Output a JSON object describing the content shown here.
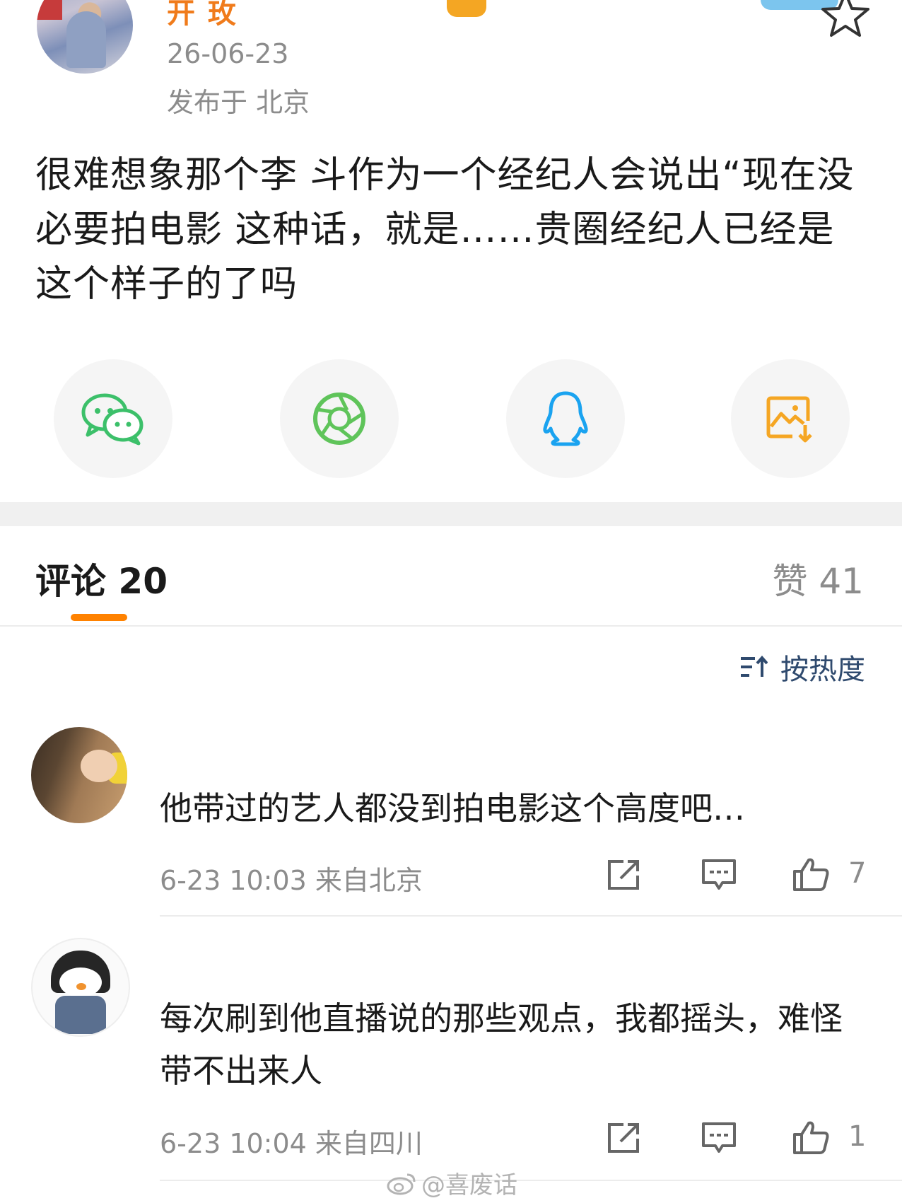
{
  "post": {
    "username": "开 玫",
    "date": "26-06-23",
    "location": "发布于 北京",
    "body": "很难想象那个李 斗作为一个经纪人会说出“现在没必要拍电影 这种话，就是……贵圈经纪人已经是这个样子的了吗"
  },
  "share": {
    "items": [
      {
        "icon": "wechat-icon",
        "color": "#3cc06a"
      },
      {
        "icon": "moments-icon",
        "color": "#5fc45a"
      },
      {
        "icon": "qq-icon",
        "color": "#1aa3f0"
      },
      {
        "icon": "save-image-icon",
        "color": "#f5a623"
      }
    ]
  },
  "tabs": {
    "comments_label": "评论 20",
    "likes_label": "赞 41",
    "accent": "#ff8200"
  },
  "sort": {
    "label": "按热度"
  },
  "comments": [
    {
      "text": "他带过的艺人都没到拍电影这个高度吧…",
      "meta": "6-23 10:03 来自北京",
      "likes": "7"
    },
    {
      "text": "每次刷到他直播说的那些观点，我都摇头，难怪带不出来人",
      "meta": "6-23 10:04 来自四川",
      "likes": "1"
    }
  ],
  "watermark": {
    "text": "@喜废话"
  }
}
